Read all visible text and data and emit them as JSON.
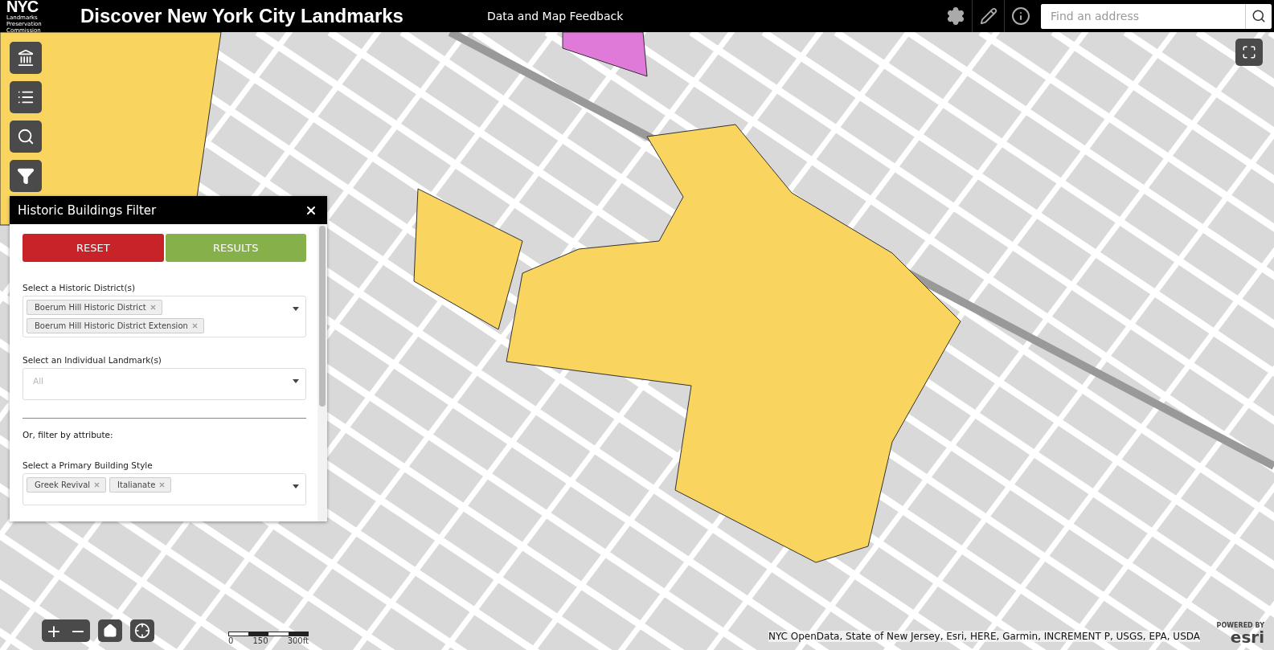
{
  "header": {
    "logo": {
      "mark": "NYC",
      "subtitle": "Landmarks Preservation Commission"
    },
    "title": "Discover New York City Landmarks",
    "feedback_link": "Data and Map Feedback",
    "search": {
      "placeholder": "Find an address"
    }
  },
  "filter_panel": {
    "title": "Historic Buildings Filter",
    "buttons": [
      {
        "label": "RESET",
        "kind": "reset"
      },
      {
        "label": "RESULTS",
        "kind": "results"
      }
    ],
    "sections": [
      {
        "kind": "select",
        "label": "Select a Historic District(s)",
        "tags": [
          "Boerum Hill Historic District",
          "Boerum Hill Historic District Extension"
        ]
      },
      {
        "kind": "select",
        "label": "Select an Individual Landmark(s)",
        "placeholder": "All"
      },
      {
        "kind": "divider"
      },
      {
        "kind": "heading",
        "label": "Or, filter by attribute:"
      },
      {
        "kind": "select",
        "label": "Select a Primary Building Style",
        "tags": [
          "Greek Revival",
          "Italianate"
        ]
      }
    ]
  },
  "zoom_controls": {
    "zoom_in": "+",
    "zoom_out": "−"
  },
  "scale_bar": {
    "labels": [
      "0",
      "150",
      "300ft"
    ]
  },
  "attribution": "NYC OpenData, State of New Jersey, Esri, HERE, Garmin, INCREMENT P, USGS, EPA, USDA",
  "esri_logo": {
    "caption": "POWERED BY",
    "wordmark": "esri"
  }
}
